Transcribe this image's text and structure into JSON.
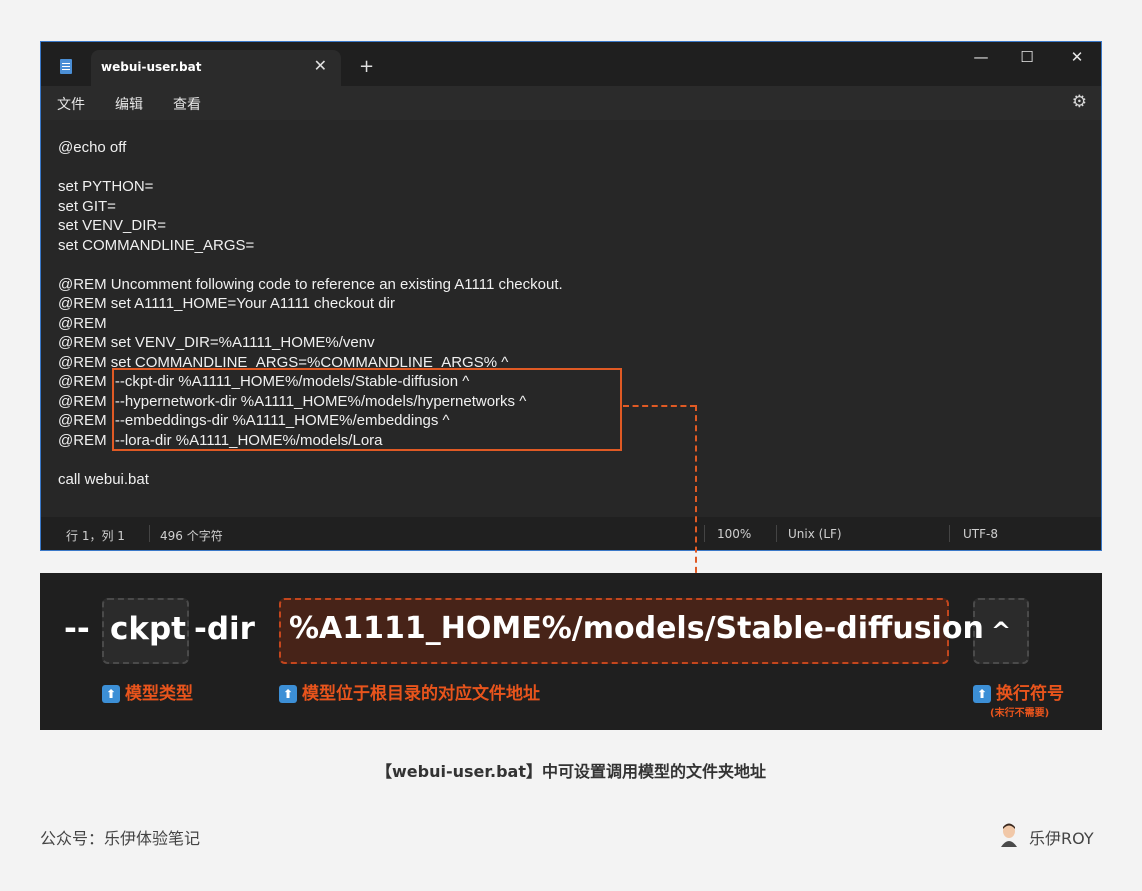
{
  "window": {
    "tab_title": "webui-user.bat",
    "tab_close": "✕",
    "new_tab": "+",
    "minimize": "—",
    "maximize": "☐",
    "close": "✕",
    "icon": "file-icon"
  },
  "menu": {
    "file": "文件",
    "edit": "编辑",
    "view": "查看",
    "settings_icon": "⚙"
  },
  "editor": {
    "lines": [
      "@echo off",
      "",
      "set PYTHON=",
      "set GIT=",
      "set VENV_DIR=",
      "set COMMANDLINE_ARGS=",
      "",
      "@REM Uncomment following code to reference an existing A1111 checkout.",
      "@REM set A1111_HOME=Your A1111 checkout dir",
      "@REM",
      "@REM set VENV_DIR=%A1111_HOME%/venv",
      "@REM set COMMANDLINE_ARGS=%COMMANDLINE_ARGS% ^",
      "@REM  --ckpt-dir %A1111_HOME%/models/Stable-diffusion ^",
      "@REM  --hypernetwork-dir %A1111_HOME%/models/hypernetworks ^",
      "@REM  --embeddings-dir %A1111_HOME%/embeddings ^",
      "@REM  --lora-dir %A1111_HOME%/models/Lora",
      "",
      "call webui.bat"
    ]
  },
  "status": {
    "position": "行 1，列 1",
    "chars": "496 个字符",
    "zoom": "100%",
    "line_ending": "Unix (LF)",
    "encoding": "UTF-8"
  },
  "explain": {
    "dashes": "--",
    "ckpt": "ckpt",
    "dir": "-dir",
    "path": "%A1111_HOME%/models/Stable-diffusion",
    "caret": "^",
    "ann_type": "模型类型",
    "ann_path": "模型位于根目录的对应文件地址",
    "ann_caret": "换行符号",
    "ann_caret_note": "(末行不需要)",
    "up_icon": "⬆"
  },
  "caption": "【webui-user.bat】中可设置调用模型的文件夹地址",
  "footer": {
    "left": "公众号：乐伊体验笔记",
    "right": "乐伊ROY"
  },
  "colors": {
    "accent": "#e05a24",
    "window_bg": "#272727",
    "panel_bg": "#1f1f1f"
  }
}
